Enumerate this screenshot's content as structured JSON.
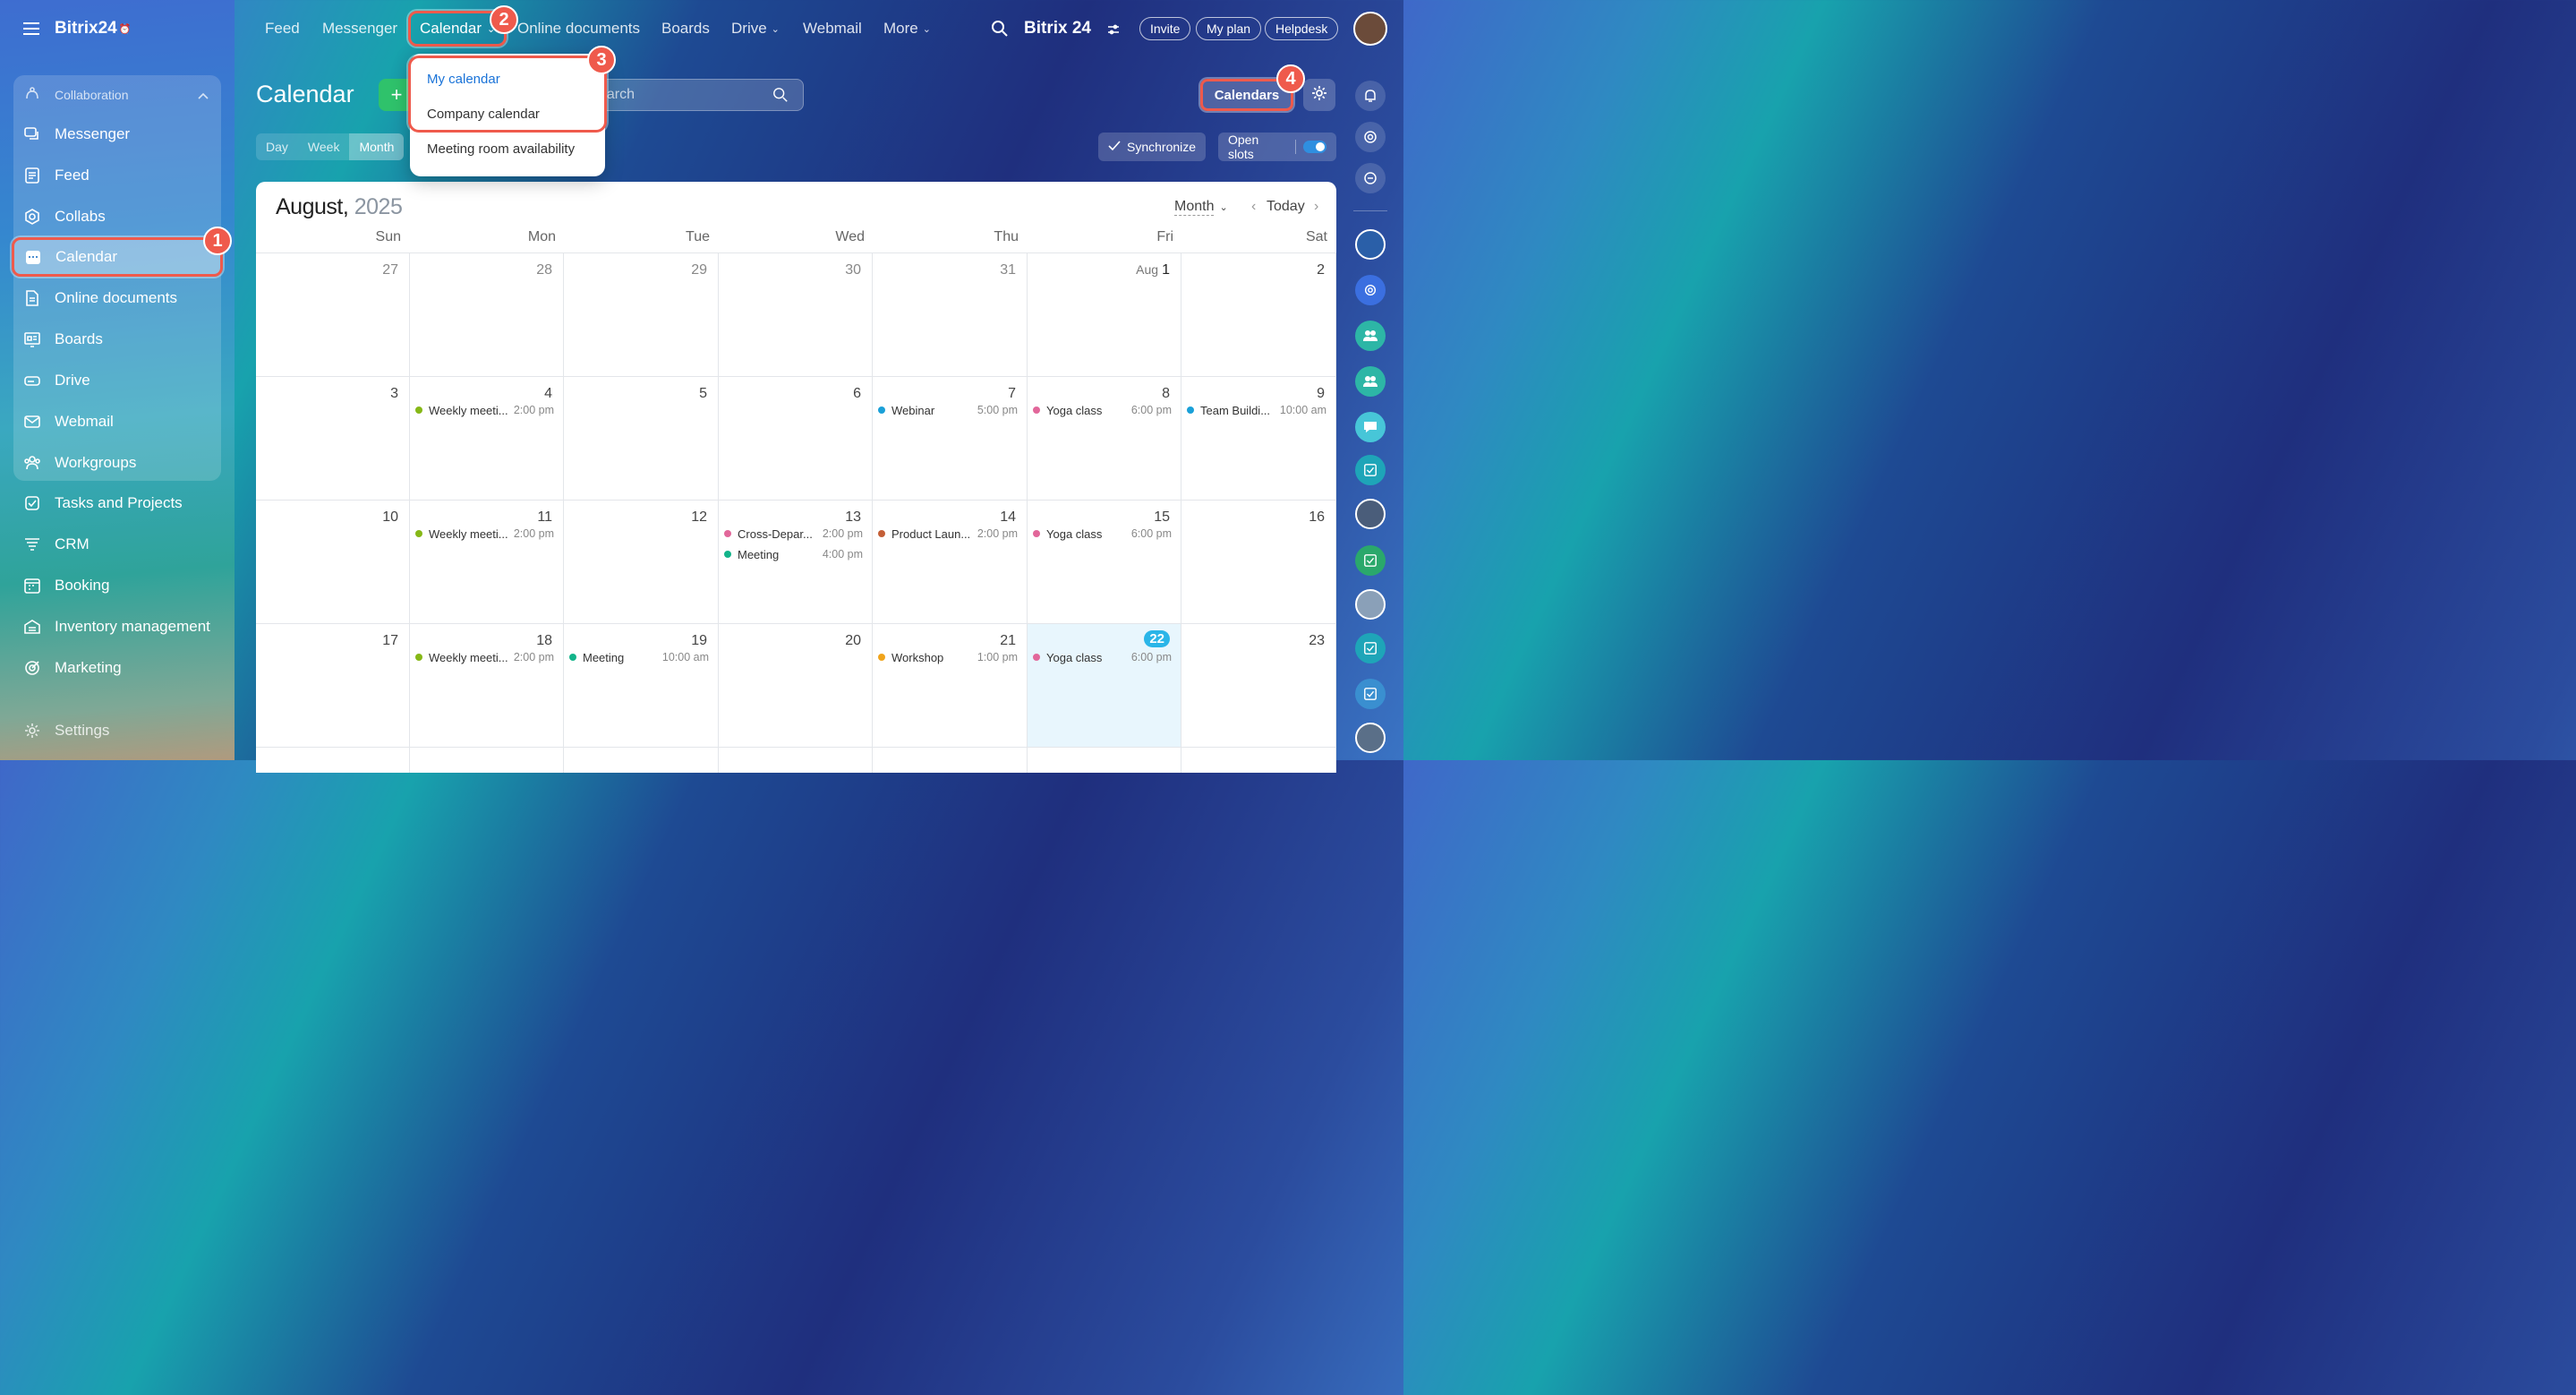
{
  "app": {
    "brand": "Bitrix24",
    "brand_suffix": "⏰"
  },
  "topnav": {
    "items": [
      "Feed",
      "Messenger",
      "Calendar",
      "Online documents",
      "Boards",
      "Drive",
      "Webmail",
      "More"
    ],
    "brand": "Bitrix 24",
    "invite": "Invite",
    "my_plan": "My plan",
    "helpdesk": "Helpdesk"
  },
  "sidebar": {
    "group_label": "Collaboration",
    "items": [
      "Messenger",
      "Feed",
      "Collabs",
      "Calendar",
      "Online documents",
      "Boards",
      "Drive",
      "Webmail",
      "Workgroups",
      "Tasks and Projects",
      "CRM",
      "Booking",
      "Inventory management",
      "Marketing",
      "Settings"
    ]
  },
  "toolbar": {
    "title": "Calendar",
    "add": "+",
    "search_placeholder": "earch",
    "views": [
      "Day",
      "Week",
      "Month"
    ],
    "synchronize": "Synchronize",
    "open_slots": "Open slots",
    "calendars": "Calendars"
  },
  "dropdown": {
    "items": [
      "My calendar",
      "Company calendar",
      "Meeting room availability"
    ]
  },
  "badges": [
    "1",
    "2",
    "3",
    "4"
  ],
  "calendar": {
    "month": "August,",
    "year": "2025",
    "view_select": "Month",
    "today": "Today",
    "weekdays": [
      "Sun",
      "Mon",
      "Tue",
      "Wed",
      "Thu",
      "Fri",
      "Sat"
    ],
    "days": [
      [
        "27",
        "28",
        "29",
        "30",
        "31",
        "1",
        "2"
      ],
      [
        "3",
        "4",
        "5",
        "6",
        "7",
        "8",
        "9"
      ],
      [
        "10",
        "11",
        "12",
        "13",
        "14",
        "15",
        "16"
      ],
      [
        "17",
        "18",
        "19",
        "20",
        "21",
        "22",
        "23"
      ]
    ],
    "aug_prefix": "Aug",
    "events": {
      "w2_mon": {
        "name": "Weekly meeti...",
        "time": "2:00 pm"
      },
      "w2_thu": {
        "name": "Webinar",
        "time": "5:00 pm"
      },
      "w2_fri": {
        "name": "Yoga class",
        "time": "6:00 pm"
      },
      "w2_sat": {
        "name": "Team Buildi...",
        "time": "10:00 am"
      },
      "w3_mon": {
        "name": "Weekly meeti...",
        "time": "2:00 pm"
      },
      "w3_wed1": {
        "name": "Cross-Depar...",
        "time": "2:00 pm"
      },
      "w3_wed2": {
        "name": "Meeting",
        "time": "4:00 pm"
      },
      "w3_thu": {
        "name": "Product Laun...",
        "time": "2:00 pm"
      },
      "w3_fri": {
        "name": "Yoga class",
        "time": "6:00 pm"
      },
      "w4_mon": {
        "name": "Weekly meeti...",
        "time": "2:00 pm"
      },
      "w4_tue": {
        "name": "Meeting",
        "time": "10:00 am"
      },
      "w4_thu": {
        "name": "Workshop",
        "time": "1:00 pm"
      },
      "w4_fri": {
        "name": "Yoga class",
        "time": "6:00 pm"
      }
    }
  },
  "colors": {
    "highlight": "#ef5a4c",
    "green_event": "#86b817",
    "blue_event": "#1aa0d8",
    "pink_event": "#e2679a",
    "teal_event": "#13b48a",
    "brown_event": "#c45f37",
    "orange_event": "#f0a41b",
    "today": "#2ab5e8",
    "accent_link": "#1a73d8"
  }
}
